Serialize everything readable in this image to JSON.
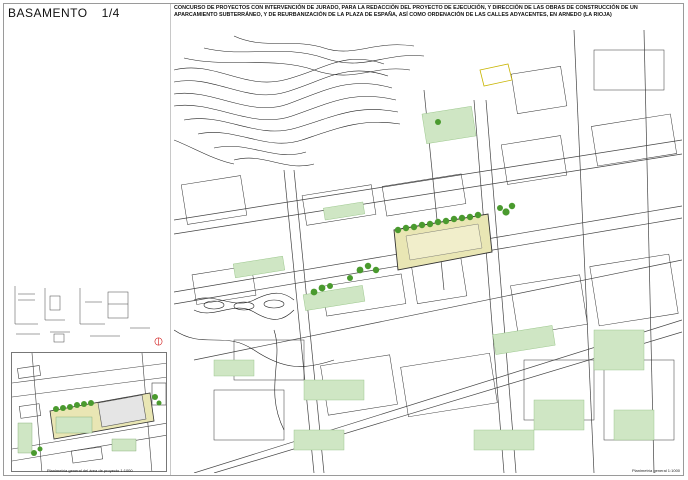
{
  "sheet": {
    "title": "BASAMENTO",
    "number": "1/4"
  },
  "header": {
    "text": "CONCURSO DE PROYECTOS CON INTERVENCIÓN DE JURADO, PARA LA REDACCIÓN DEL PROYECTO DE EJECUCIÓN, Y DIRECCIÓN DE LAS OBRAS DE CONSTRUCCIÓN DE UN APARCAMIENTO SUBTERRÁNEO, Y DE REURBANIZACIÓN DE LA PLAZA DE ESPAÑA, ASÍ COMO ORDENACIÓN DE LAS CALLES ADYACENTES, EN ARNEDO (LA RIOJA)"
  },
  "inset": {
    "caption": "Planimetría general del área de proyecto 1:1000"
  },
  "map": {
    "caption": "Planimetría general 1:1000"
  },
  "colors": {
    "ink": "#111111",
    "green_area": "#cfe6c4",
    "tree": "#4a9a2e",
    "plaza": "#e9e6b4",
    "road_line": "#444444"
  },
  "icons": {
    "north": "north-arrow-icon"
  }
}
